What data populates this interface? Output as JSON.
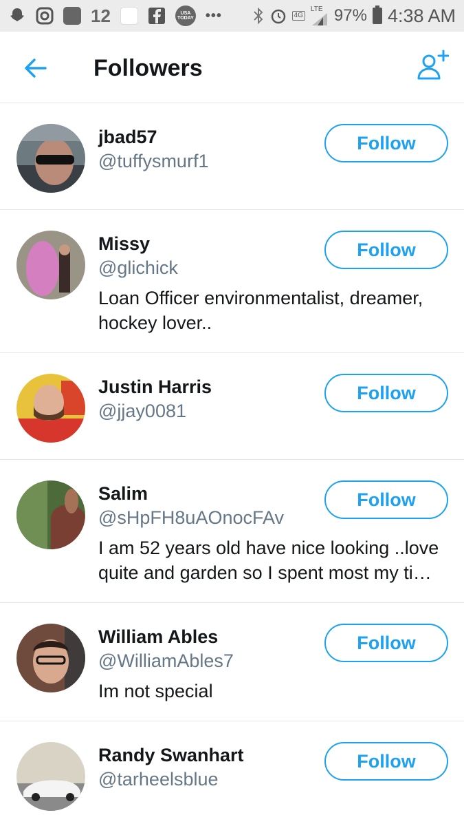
{
  "status_bar": {
    "number_badge": "12",
    "usa_today": "USA TODAY",
    "network": "4G",
    "lte": "LTE",
    "battery": "97%",
    "time": "4:38 AM"
  },
  "header": {
    "title": "Followers"
  },
  "accent_color": "#1da1f2",
  "followers": [
    {
      "name": "jbad57",
      "handle": "@tuffysmurf1",
      "bio": "",
      "button": "Follow"
    },
    {
      "name": "Missy",
      "handle": "@glichick",
      "bio": "Loan Officer environmentalist, dreamer, hockey lover..",
      "button": "Follow"
    },
    {
      "name": "Justin Harris",
      "handle": "@jjay0081",
      "bio": "",
      "button": "Follow"
    },
    {
      "name": "Salim",
      "handle": "@sHpFH8uAOnocFAv",
      "bio": "I am 52 years old have nice looking ..love quite and garden so I spent most my ti…",
      "button": "Follow"
    },
    {
      "name": "William Ables",
      "handle": "@WilliamAbles7",
      "bio": "Im not special",
      "button": "Follow"
    },
    {
      "name": "Randy Swanhart",
      "handle": "@tarheelsblue",
      "bio": "",
      "button": "Follow"
    }
  ]
}
